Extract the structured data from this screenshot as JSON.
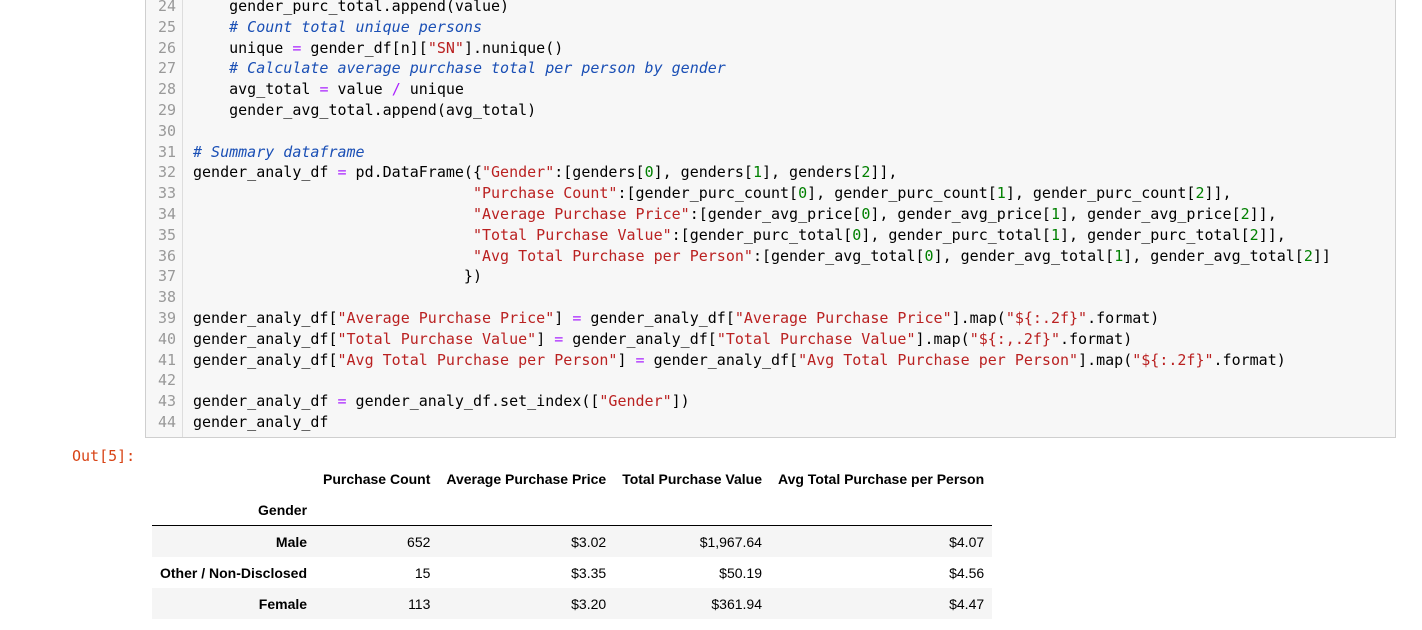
{
  "code": {
    "lines": [
      {
        "n": "24",
        "segs": [
          {
            "t": "    gender_purc_total.append(value)",
            "k": ""
          }
        ]
      },
      {
        "n": "25",
        "segs": [
          {
            "t": "    ",
            "k": ""
          },
          {
            "t": "# Count total unique persons",
            "k": "c"
          }
        ]
      },
      {
        "n": "26",
        "segs": [
          {
            "t": "    unique ",
            "k": ""
          },
          {
            "t": "=",
            "k": "o"
          },
          {
            "t": " gender_df[n][",
            "k": ""
          },
          {
            "t": "\"SN\"",
            "k": "s"
          },
          {
            "t": "].nunique()",
            "k": ""
          }
        ]
      },
      {
        "n": "27",
        "segs": [
          {
            "t": "    ",
            "k": ""
          },
          {
            "t": "# Calculate average purchase total per person by gender",
            "k": "c"
          }
        ]
      },
      {
        "n": "28",
        "segs": [
          {
            "t": "    avg_total ",
            "k": ""
          },
          {
            "t": "=",
            "k": "o"
          },
          {
            "t": " value ",
            "k": ""
          },
          {
            "t": "/",
            "k": "o"
          },
          {
            "t": " unique",
            "k": ""
          }
        ]
      },
      {
        "n": "29",
        "segs": [
          {
            "t": "    gender_avg_total.append(avg_total)",
            "k": ""
          }
        ]
      },
      {
        "n": "30",
        "segs": []
      },
      {
        "n": "31",
        "segs": [
          {
            "t": "# Summary dataframe",
            "k": "c"
          }
        ]
      },
      {
        "n": "32",
        "segs": [
          {
            "t": "gender_analy_df ",
            "k": ""
          },
          {
            "t": "=",
            "k": "o"
          },
          {
            "t": " pd.DataFrame({",
            "k": ""
          },
          {
            "t": "\"Gender\"",
            "k": "s"
          },
          {
            "t": ":[genders[",
            "k": ""
          },
          {
            "t": "0",
            "k": "n"
          },
          {
            "t": "], genders[",
            "k": ""
          },
          {
            "t": "1",
            "k": "n"
          },
          {
            "t": "], genders[",
            "k": ""
          },
          {
            "t": "2",
            "k": "n"
          },
          {
            "t": "]],",
            "k": ""
          }
        ]
      },
      {
        "n": "33",
        "segs": [
          {
            "t": "                               ",
            "k": ""
          },
          {
            "t": "\"Purchase Count\"",
            "k": "s"
          },
          {
            "t": ":[gender_purc_count[",
            "k": ""
          },
          {
            "t": "0",
            "k": "n"
          },
          {
            "t": "], gender_purc_count[",
            "k": ""
          },
          {
            "t": "1",
            "k": "n"
          },
          {
            "t": "], gender_purc_count[",
            "k": ""
          },
          {
            "t": "2",
            "k": "n"
          },
          {
            "t": "]],",
            "k": ""
          }
        ]
      },
      {
        "n": "34",
        "segs": [
          {
            "t": "                               ",
            "k": ""
          },
          {
            "t": "\"Average Purchase Price\"",
            "k": "s"
          },
          {
            "t": ":[gender_avg_price[",
            "k": ""
          },
          {
            "t": "0",
            "k": "n"
          },
          {
            "t": "], gender_avg_price[",
            "k": ""
          },
          {
            "t": "1",
            "k": "n"
          },
          {
            "t": "], gender_avg_price[",
            "k": ""
          },
          {
            "t": "2",
            "k": "n"
          },
          {
            "t": "]],",
            "k": ""
          }
        ]
      },
      {
        "n": "35",
        "segs": [
          {
            "t": "                               ",
            "k": ""
          },
          {
            "t": "\"Total Purchase Value\"",
            "k": "s"
          },
          {
            "t": ":[gender_purc_total[",
            "k": ""
          },
          {
            "t": "0",
            "k": "n"
          },
          {
            "t": "], gender_purc_total[",
            "k": ""
          },
          {
            "t": "1",
            "k": "n"
          },
          {
            "t": "], gender_purc_total[",
            "k": ""
          },
          {
            "t": "2",
            "k": "n"
          },
          {
            "t": "]],",
            "k": ""
          }
        ]
      },
      {
        "n": "36",
        "segs": [
          {
            "t": "                               ",
            "k": ""
          },
          {
            "t": "\"Avg Total Purchase per Person\"",
            "k": "s"
          },
          {
            "t": ":[gender_avg_total[",
            "k": ""
          },
          {
            "t": "0",
            "k": "n"
          },
          {
            "t": "], gender_avg_total[",
            "k": ""
          },
          {
            "t": "1",
            "k": "n"
          },
          {
            "t": "], gender_avg_total[",
            "k": ""
          },
          {
            "t": "2",
            "k": "n"
          },
          {
            "t": "]]",
            "k": ""
          }
        ]
      },
      {
        "n": "37",
        "segs": [
          {
            "t": "                              })",
            "k": ""
          }
        ]
      },
      {
        "n": "38",
        "segs": []
      },
      {
        "n": "39",
        "segs": [
          {
            "t": "gender_analy_df[",
            "k": ""
          },
          {
            "t": "\"Average Purchase Price\"",
            "k": "s"
          },
          {
            "t": "] ",
            "k": ""
          },
          {
            "t": "=",
            "k": "o"
          },
          {
            "t": " gender_analy_df[",
            "k": ""
          },
          {
            "t": "\"Average Purchase Price\"",
            "k": "s"
          },
          {
            "t": "].map(",
            "k": ""
          },
          {
            "t": "\"${:.2f}\"",
            "k": "s"
          },
          {
            "t": ".format)",
            "k": ""
          }
        ]
      },
      {
        "n": "40",
        "segs": [
          {
            "t": "gender_analy_df[",
            "k": ""
          },
          {
            "t": "\"Total Purchase Value\"",
            "k": "s"
          },
          {
            "t": "] ",
            "k": ""
          },
          {
            "t": "=",
            "k": "o"
          },
          {
            "t": " gender_analy_df[",
            "k": ""
          },
          {
            "t": "\"Total Purchase Value\"",
            "k": "s"
          },
          {
            "t": "].map(",
            "k": ""
          },
          {
            "t": "\"${:,.2f}\"",
            "k": "s"
          },
          {
            "t": ".format)",
            "k": ""
          }
        ]
      },
      {
        "n": "41",
        "segs": [
          {
            "t": "gender_analy_df[",
            "k": ""
          },
          {
            "t": "\"Avg Total Purchase per Person\"",
            "k": "s"
          },
          {
            "t": "] ",
            "k": ""
          },
          {
            "t": "=",
            "k": "o"
          },
          {
            "t": " gender_analy_df[",
            "k": ""
          },
          {
            "t": "\"Avg Total Purchase per Person\"",
            "k": "s"
          },
          {
            "t": "].map(",
            "k": ""
          },
          {
            "t": "\"${:.2f}\"",
            "k": "s"
          },
          {
            "t": ".format)",
            "k": ""
          }
        ]
      },
      {
        "n": "42",
        "segs": []
      },
      {
        "n": "43",
        "segs": [
          {
            "t": "gender_analy_df ",
            "k": ""
          },
          {
            "t": "=",
            "k": "o"
          },
          {
            "t": " gender_analy_df.set_index([",
            "k": ""
          },
          {
            "t": "\"Gender\"",
            "k": "s"
          },
          {
            "t": "])",
            "k": ""
          }
        ]
      },
      {
        "n": "44",
        "segs": [
          {
            "t": "gender_analy_df",
            "k": ""
          }
        ]
      }
    ]
  },
  "output": {
    "prompt": "Out[5]:",
    "table": {
      "columns": [
        "Purchase Count",
        "Average Purchase Price",
        "Total Purchase Value",
        "Avg Total Purchase per Person"
      ],
      "index_name": "Gender",
      "rows": [
        {
          "index": "Male",
          "cells": [
            "652",
            "$3.02",
            "$1,967.64",
            "$4.07"
          ]
        },
        {
          "index": "Other / Non-Disclosed",
          "cells": [
            "15",
            "$3.35",
            "$50.19",
            "$4.56"
          ]
        },
        {
          "index": "Female",
          "cells": [
            "113",
            "$3.20",
            "$361.94",
            "$4.47"
          ]
        }
      ]
    }
  }
}
